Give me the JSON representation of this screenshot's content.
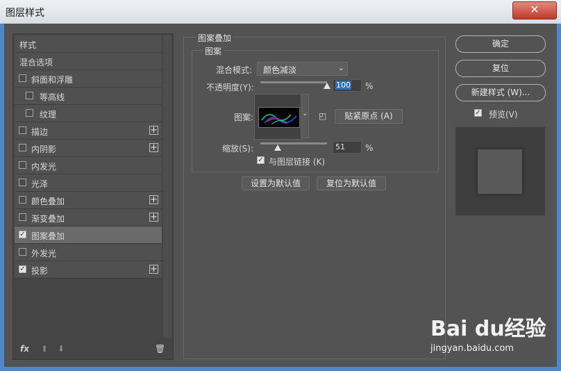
{
  "window": {
    "title": "图层样式",
    "close_glyph": "✕"
  },
  "left_panel": {
    "items": [
      {
        "label": "样式",
        "checkbox": false,
        "checked": false,
        "plus": false,
        "indent": false,
        "selected": false
      },
      {
        "label": "混合选项",
        "checkbox": false,
        "checked": false,
        "plus": false,
        "indent": false,
        "selected": false
      },
      {
        "label": "斜面和浮雕",
        "checkbox": true,
        "checked": false,
        "plus": false,
        "indent": false,
        "selected": false
      },
      {
        "label": "等高线",
        "checkbox": true,
        "checked": false,
        "plus": false,
        "indent": true,
        "selected": false
      },
      {
        "label": "纹理",
        "checkbox": true,
        "checked": false,
        "plus": false,
        "indent": true,
        "selected": false
      },
      {
        "label": "描边",
        "checkbox": true,
        "checked": false,
        "plus": true,
        "indent": false,
        "selected": false
      },
      {
        "label": "内阴影",
        "checkbox": true,
        "checked": false,
        "plus": true,
        "indent": false,
        "selected": false
      },
      {
        "label": "内发光",
        "checkbox": true,
        "checked": false,
        "plus": false,
        "indent": false,
        "selected": false
      },
      {
        "label": "光泽",
        "checkbox": true,
        "checked": false,
        "plus": false,
        "indent": false,
        "selected": false
      },
      {
        "label": "颜色叠加",
        "checkbox": true,
        "checked": false,
        "plus": true,
        "indent": false,
        "selected": false
      },
      {
        "label": "渐变叠加",
        "checkbox": true,
        "checked": false,
        "plus": true,
        "indent": false,
        "selected": false
      },
      {
        "label": "图案叠加",
        "checkbox": true,
        "checked": true,
        "plus": false,
        "indent": false,
        "selected": true
      },
      {
        "label": "外发光",
        "checkbox": true,
        "checked": false,
        "plus": false,
        "indent": false,
        "selected": false
      },
      {
        "label": "投影",
        "checkbox": true,
        "checked": true,
        "plus": true,
        "indent": false,
        "selected": false
      }
    ],
    "bottom": {
      "fx": "fx",
      "up": "⬆",
      "down": "⬇",
      "trash": "🗑"
    }
  },
  "pattern_overlay": {
    "section_title": "图案叠加",
    "subsection_title": "图案",
    "blend_mode_label": "混合模式:",
    "blend_mode_value": "颜色减淡",
    "opacity_label": "不透明度(Y):",
    "opacity_value": "100",
    "opacity_level": 1.0,
    "pattern_label": "图案:",
    "snap_button": "贴紧原点 (A)",
    "scale_label": "缩放(S):",
    "scale_value": "51",
    "scale_level": 0.26,
    "link_label": "与图层链接 (K)",
    "link_checked": true,
    "percent": "%",
    "set_default": "设置为默认值",
    "reset_default": "复位为默认值"
  },
  "right_panel": {
    "ok": "确定",
    "reset": "复位",
    "new_style": "新建样式 (W)...",
    "preview_label": "预览(V)",
    "preview_checked": true
  },
  "watermark": {
    "logo": "Bai du经验",
    "url": "jingyan.baidu.com"
  },
  "colors": {
    "accent": "#4d88c8",
    "close": "#c0392b",
    "selection": "#2f6fb8"
  }
}
